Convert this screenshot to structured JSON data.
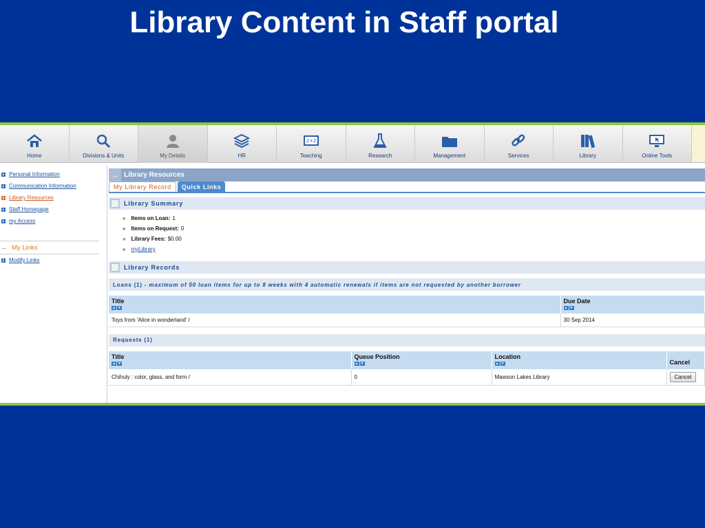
{
  "slide_title": "Library Content in Staff portal",
  "nav": [
    {
      "label": "Home",
      "icon": "home-icon"
    },
    {
      "label": "Divisions & Units",
      "icon": "magnifier-icon"
    },
    {
      "label": "My Details",
      "icon": "person-icon"
    },
    {
      "label": "HR",
      "icon": "layers-icon"
    },
    {
      "label": "Teaching",
      "icon": "chalkboard-icon"
    },
    {
      "label": "Research",
      "icon": "flask-icon"
    },
    {
      "label": "Management",
      "icon": "folder-icon"
    },
    {
      "label": "Services",
      "icon": "chain-link-icon"
    },
    {
      "label": "Library",
      "icon": "books-icon"
    },
    {
      "label": "Online Tools",
      "icon": "monitor-icon"
    }
  ],
  "sidebar": {
    "items": [
      {
        "label": "Personal Information"
      },
      {
        "label": "Communication Information"
      },
      {
        "label": "Library Resources"
      },
      {
        "label": "Staff Homepage"
      },
      {
        "label": "my Access"
      }
    ],
    "my_links": "My Links",
    "modify_links": "Modify Links"
  },
  "main": {
    "section_title": "Library Resources",
    "tabs": [
      {
        "label": "My Library Record"
      },
      {
        "label": "Quick Links"
      }
    ],
    "summary": {
      "heading": "Library Summary",
      "loan_label": "Items on Loan:",
      "loan_value": "1",
      "request_label": "Items on Request:",
      "request_value": "0",
      "fees_label": "Library Fees:",
      "fees_value": "$0.00",
      "link": "myLibrary"
    },
    "records_heading": "Library Records",
    "loans": {
      "heading_prefix": "Loans (1) - ",
      "heading_note": "maximum of 50 loan items for up to 8 weeks with 4 automatic renewals if items are not requested by another borrower",
      "columns": [
        "Title",
        "Due Date"
      ],
      "rows": [
        {
          "title": "Toys from 'Alice in wonderland' /",
          "due": "30 Sep 2014"
        }
      ]
    },
    "requests": {
      "heading": "Requests (1)",
      "columns": [
        "Title",
        "Queue Position",
        "Location",
        "Cancel"
      ],
      "rows": [
        {
          "title": "Chihuly : color, glass, and form /",
          "queue": "0",
          "location": "Mawson Lakes Library",
          "cancel": "Cancel"
        }
      ]
    }
  },
  "colors": {
    "slide_bg": "#003399",
    "accent_green": "#8dc63f",
    "link_blue": "#1a4fa0",
    "active_orange": "#d85a1a",
    "header_blue": "#c5dbf0"
  }
}
